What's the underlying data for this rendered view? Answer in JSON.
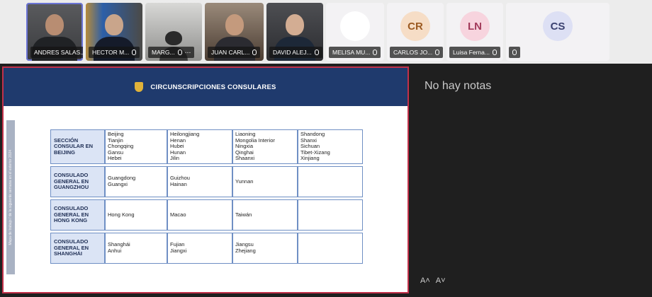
{
  "participants": [
    {
      "name": "ANDRES SALAS..."
    },
    {
      "name": "HECTOR M..."
    },
    {
      "name": "MARG..."
    },
    {
      "name": "JUAN CARL..."
    },
    {
      "name": "DAVID ALEJ..."
    },
    {
      "name": "MELISA MU..."
    },
    {
      "name": "CARLOS JO...",
      "initials": "CR",
      "color": "#f6ddc6",
      "text_color": "#9c5a22"
    },
    {
      "name": "Luisa Ferna...",
      "initials": "LN",
      "color": "#f7d4de",
      "text_color": "#a23a5a"
    },
    {
      "name": "",
      "initials": "CS",
      "color": "#dde0f4",
      "text_color": "#3b4170"
    }
  ],
  "overflow_icon": "more-icon",
  "slide": {
    "title": "CIRCUNSCRIPCIONES CONSULARES",
    "side_note": "Mapa de trabajo / de la siguiente semana en el exterior 2024",
    "rows": [
      {
        "label": "SECCIÓN CONSULAR EN BEIJING",
        "cells": [
          "Beijing\nTianjin\nChongqing\nGansu\nHebei",
          "Heilongjiang\nHenan\nHubei\nHunan\nJilin",
          "Liaoning\nMongolia Interior\nNingxia\nQinghai\nShaanxi",
          "Shandong\nShanxi\nSichuan\nTibet-Xizang\nXinjiang"
        ]
      },
      {
        "label": "CONSULADO GENERAL EN GUANGZHOU",
        "cells": [
          "Guangdong\nGuangxi",
          "Guizhou\nHainan",
          "Yunnan",
          ""
        ]
      },
      {
        "label": "CONSULADO GENERAL EN HONG KONG",
        "cells": [
          "Hong Kong",
          "Macao",
          "Taiwán",
          ""
        ]
      },
      {
        "label": "CONSULADO GENERAL EN SHANGHÁI",
        "cells": [
          "Shanghái\nAnhui",
          "Fujian\nJiangxi",
          "Jiangsu\nZhejiang",
          ""
        ]
      }
    ]
  },
  "notes": {
    "empty_text": "No hay notas",
    "font_decrease": "A˄",
    "font_increase": "A˅"
  }
}
